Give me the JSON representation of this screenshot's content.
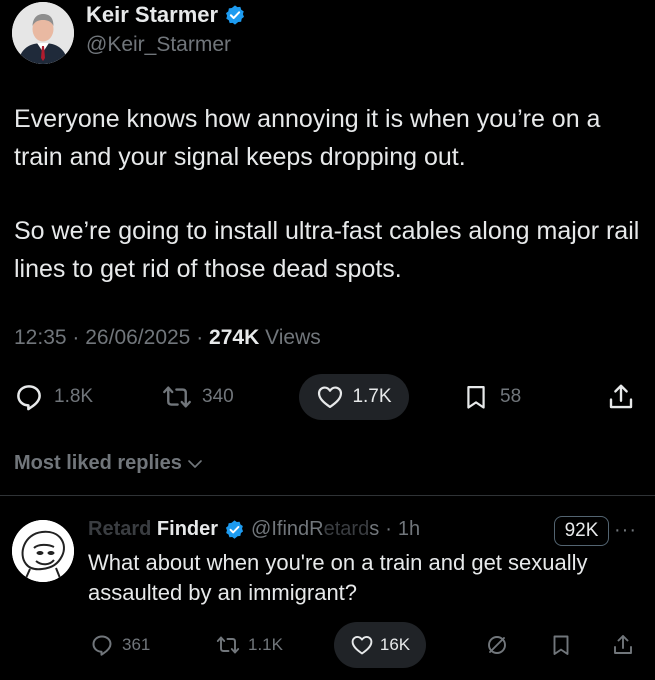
{
  "tweet": {
    "author_name": "Keir Starmer",
    "author_handle": "@Keir_Starmer",
    "verified": true,
    "text_paragraphs": [
      "Everyone knows how annoying it is when you’re on a train and your signal keeps dropping out.",
      "So we’re going to install ultra-fast cables along major rail lines to get rid of those dead spots."
    ],
    "time": "12:35",
    "date": "26/06/2025",
    "views_count": "274K",
    "views_label": "Views",
    "separator": "·"
  },
  "actions": {
    "replies": "1.8K",
    "reposts": "340",
    "likes": "1.7K",
    "bookmarks": "58"
  },
  "replies_section": {
    "label": "Most liked replies"
  },
  "reply": {
    "name_visible_start": "Re",
    "name_faded": "tard",
    "name_end": " Finder",
    "handle_start": "@IfindR",
    "handle_faded": "etard",
    "handle_end": "s",
    "age": "1h",
    "separator": "·",
    "badge": "92K",
    "more": "···",
    "text": "What about when you're on a train and get sexually assaulted by an immigrant?",
    "replies": "361",
    "reposts": "1.1K",
    "likes": "16K"
  },
  "colors": {
    "background": "#000000",
    "text_primary": "#e7e9ea",
    "text_secondary": "#71767b",
    "verified_blue": "#1d9bf0",
    "pill_bg": "#202327",
    "divider": "#2f3336"
  },
  "icons": {
    "verified": "verified-badge-icon",
    "reply": "reply-bubble-icon",
    "repost": "repost-arrows-icon",
    "like": "heart-icon",
    "bookmark": "bookmark-icon",
    "share": "share-upload-icon",
    "grok": "grok-slash-icon",
    "chevron": "chevron-down-icon"
  }
}
